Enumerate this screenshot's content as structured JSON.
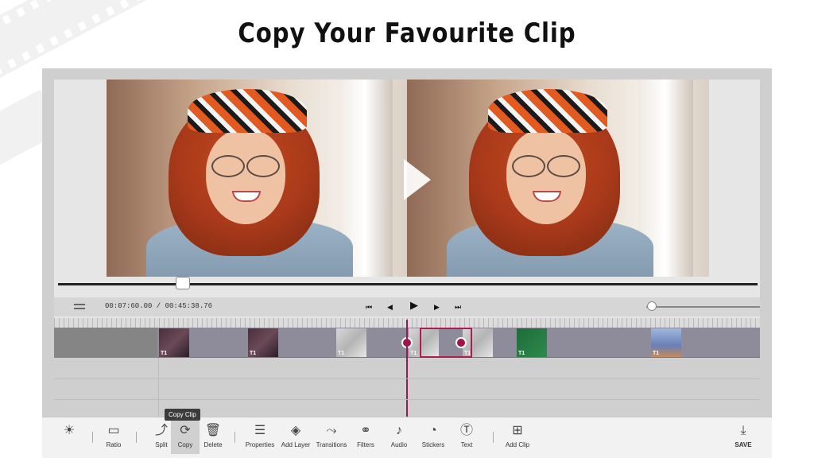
{
  "headline": "Copy Your Favourite Clip",
  "transport": {
    "timecode": "00:07:60.00 / 00:45:38.76",
    "skip_start": "⏮",
    "step_back": "◀",
    "play": "▶",
    "step_forward": "▶",
    "skip_end": "⏭"
  },
  "clips": [
    {
      "label": "T1"
    },
    {
      "label": "T1"
    },
    {
      "label": "T1"
    },
    {
      "label": "T1"
    },
    {
      "label": "T1"
    },
    {
      "label": "T1"
    },
    {
      "label": "T1"
    }
  ],
  "tooltip": "Copy Clip",
  "toolbar": {
    "ratio": "Ratio",
    "split": "Split",
    "copy": "Copy",
    "delete": "Delete",
    "properties": "Properties",
    "add_layer": "Add Layer",
    "transitions": "Transitions",
    "filters": "Filters",
    "audio": "Audio",
    "stickers": "Stickers",
    "text": "Text",
    "add_clip": "Add Clip",
    "save": "SAVE"
  },
  "colors": {
    "accent": "#9e1550",
    "track": "#8e8b9b"
  }
}
